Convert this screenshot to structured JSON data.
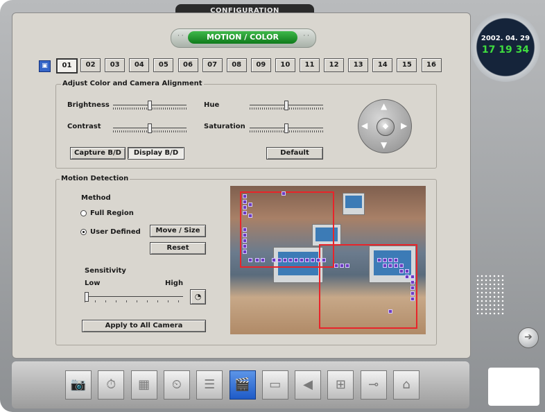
{
  "window": {
    "title": "CONFIGURATION"
  },
  "mode": {
    "title": "MOTION / COLOR",
    "left_dots": "· ·",
    "right_dots": "· ·"
  },
  "camera_tabs": [
    "01",
    "02",
    "03",
    "04",
    "05",
    "06",
    "07",
    "08",
    "09",
    "10",
    "11",
    "12",
    "13",
    "14",
    "15",
    "16"
  ],
  "selected_camera": "01",
  "color_section": {
    "legend": "Adjust Color and Camera Alignment",
    "brightness": {
      "label": "Brightness",
      "value": 0.5
    },
    "contrast": {
      "label": "Contrast",
      "value": 0.5
    },
    "hue": {
      "label": "Hue",
      "value": 0.5
    },
    "saturation": {
      "label": "Saturation",
      "value": 0.5
    },
    "capture_button": "Capture B/D",
    "display_button": "Display B/D",
    "default_button": "Default"
  },
  "motion_section": {
    "legend": "Motion Detection",
    "method_label": "Method",
    "full_region_label": "Full Region",
    "user_defined_label": "User Defined",
    "method_selected": "User Defined",
    "move_size_button": "Move / Size",
    "reset_button": "Reset",
    "sensitivity_label": "Sensitivity",
    "low_label": "Low",
    "high_label": "High",
    "sensitivity_value": 0.0,
    "apply_button": "Apply to All Camera"
  },
  "clock": {
    "date": "2002. 04. 29",
    "time": "17 19 34"
  },
  "toolbar": [
    "camera-icon",
    "timer-icon",
    "calendar-icon",
    "schedule-icon",
    "user-list-icon",
    "motion-color-icon",
    "monitor-icon",
    "speaker-icon",
    "network-icon",
    "key-icon",
    "home-info-icon"
  ],
  "toolbar_active": "motion-color-icon",
  "colors": {
    "accent_green": "#1f9a2b",
    "region_red": "#e8242a",
    "active_blue": "#1f5bc7"
  }
}
